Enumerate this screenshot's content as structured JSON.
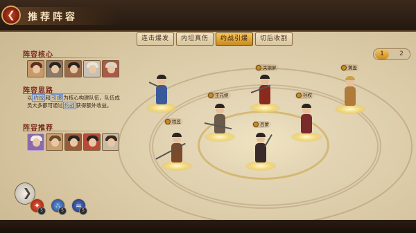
{
  "header": {
    "title": "推荐阵容",
    "back_icon": "back-arrow-icon"
  },
  "tabs": [
    {
      "label": "连击爆发",
      "active": false
    },
    {
      "label": "内坦真伤",
      "active": false
    },
    {
      "label": "约战引爆",
      "active": true
    },
    {
      "label": "切后收割",
      "active": false
    }
  ],
  "pager": {
    "pages": [
      "1",
      "2"
    ],
    "current": "1"
  },
  "panel": {
    "core_title": "阵容核心",
    "idea_title": "阵容思路",
    "recommend_title": "阵容推荐",
    "desc_parts": {
      "p1": "以",
      "kw1": "约战",
      "p2": "和",
      "kw2": "引爆",
      "p3": "为核心构建队伍，队伍成员大多都可通过",
      "kw3": "约战",
      "p4": "获得额外收益。"
    },
    "skills": [
      {
        "icon": "flame-icon",
        "level": "5",
        "color": "#c83a28"
      },
      {
        "icon": "triple-orb-icon",
        "level": "5",
        "color": "#3a6ab8"
      },
      {
        "icon": "wave-slash-icon",
        "level": "5",
        "color": "#2a4aa0"
      }
    ]
  },
  "heroes": [
    {
      "name": "",
      "color": "#3a5a9a"
    },
    {
      "name": "关银屏",
      "color": "#8a2a1e"
    },
    {
      "name": "王元姬",
      "color": "#6a5a4a"
    },
    {
      "name": "黄盖",
      "color": "#b07a3a"
    },
    {
      "name": "孙权",
      "color": "#7a2a2a"
    },
    {
      "name": "程昱",
      "color": "#7a4a2a"
    },
    {
      "name": "吕蒙",
      "color": "#3a2a2a"
    }
  ],
  "colors": {
    "accent": "#c98a22",
    "title": "#f2e2c0",
    "section": "#7a2a1a",
    "keyword": "#2a5aa8"
  }
}
